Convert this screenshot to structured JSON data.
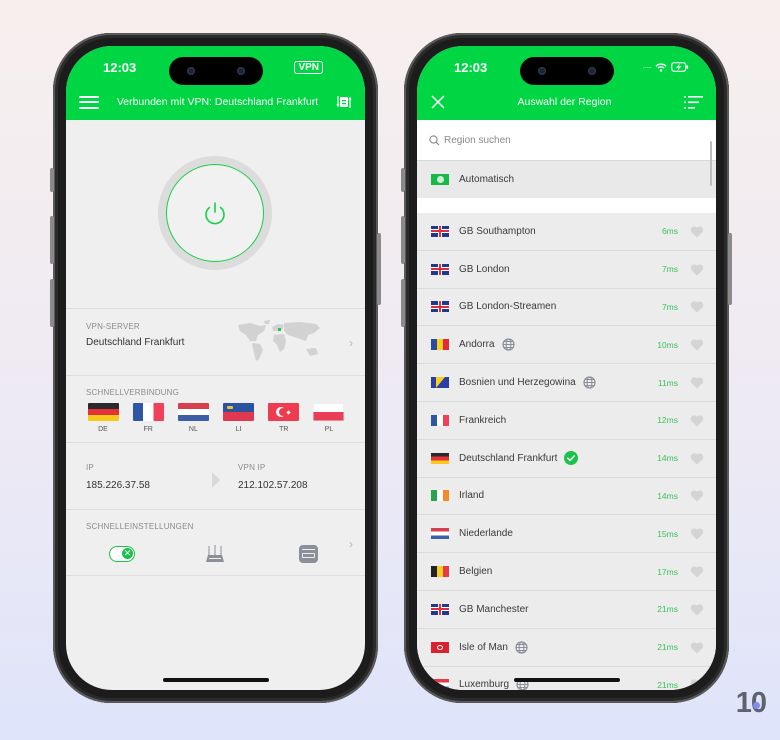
{
  "colors": {
    "brand_green": "#00d643",
    "latency_green": "#39c25a",
    "background": "#efefef"
  },
  "left_phone": {
    "status_bar": {
      "time": "12:03",
      "vpn_badge": "VPN"
    },
    "header": {
      "title": "Verbunden mit VPN: Deutschland Frankfurt",
      "menu_icon": "hamburger-icon",
      "switch_icon": "server-switch-icon"
    },
    "power_button": {
      "state": "connected",
      "icon": "power-icon"
    },
    "vpn_server": {
      "label": "VPN-SERVER",
      "value": "Deutschland Frankfurt",
      "map_icon": "world-map"
    },
    "quick_connect": {
      "label": "SCHNELLVERBINDUNG",
      "countries": [
        {
          "code": "DE"
        },
        {
          "code": "FR"
        },
        {
          "code": "NL"
        },
        {
          "code": "LI"
        },
        {
          "code": "TR"
        },
        {
          "code": "PL"
        }
      ]
    },
    "ip": {
      "label": "IP",
      "value": "185.226.37.58",
      "vpn_label": "VPN IP",
      "vpn_value": "212.102.57.208"
    },
    "quick_settings": {
      "label": "SCHNELLEINSTELLUNGEN",
      "items": [
        "kill-switch-toggle",
        "router-icon",
        "ad-block-icon"
      ]
    }
  },
  "right_phone": {
    "status_bar": {
      "time": "12:03"
    },
    "header": {
      "title": "Auswahl der Region",
      "close_icon": "close-icon",
      "sort_icon": "sort-icon"
    },
    "search": {
      "placeholder": "Region suchen"
    },
    "auto": {
      "label": "Automatisch"
    },
    "regions": [
      {
        "name": "GB Southampton",
        "flag": "GB",
        "ms": "6ms",
        "globe": false,
        "selected": false
      },
      {
        "name": "GB London",
        "flag": "GB",
        "ms": "7ms",
        "globe": false,
        "selected": false
      },
      {
        "name": "GB London-Streamen",
        "flag": "GB",
        "ms": "7ms",
        "globe": false,
        "selected": false
      },
      {
        "name": "Andorra",
        "flag": "AD",
        "ms": "10ms",
        "globe": true,
        "selected": false
      },
      {
        "name": "Bosnien und Herzegowina",
        "flag": "BA",
        "ms": "11ms",
        "globe": true,
        "selected": false
      },
      {
        "name": "Frankreich",
        "flag": "FR",
        "ms": "12ms",
        "globe": false,
        "selected": false
      },
      {
        "name": "Deutschland Frankfurt",
        "flag": "DE",
        "ms": "14ms",
        "globe": false,
        "selected": true
      },
      {
        "name": "Irland",
        "flag": "IE",
        "ms": "14ms",
        "globe": false,
        "selected": false
      },
      {
        "name": "Niederlande",
        "flag": "NL",
        "ms": "15ms",
        "globe": false,
        "selected": false
      },
      {
        "name": "Belgien",
        "flag": "BE",
        "ms": "17ms",
        "globe": false,
        "selected": false
      },
      {
        "name": "GB Manchester",
        "flag": "GB",
        "ms": "21ms",
        "globe": false,
        "selected": false
      },
      {
        "name": "Isle of Man",
        "flag": "IM",
        "ms": "21ms",
        "globe": true,
        "selected": false
      },
      {
        "name": "Luxemburg",
        "flag": "LU",
        "ms": "21ms",
        "globe": true,
        "selected": false
      }
    ]
  },
  "watermark": {
    "text": "10"
  }
}
